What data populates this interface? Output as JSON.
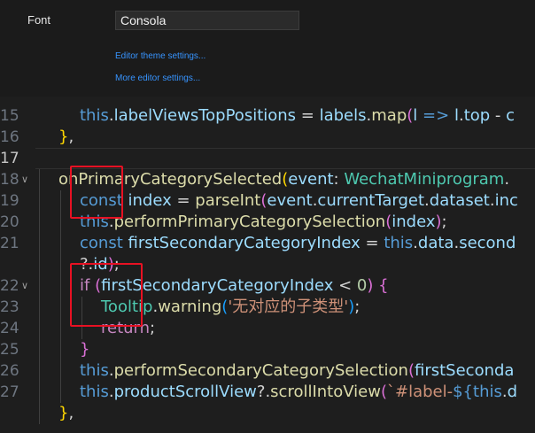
{
  "settings": {
    "font_label": "Font",
    "font_value": "Consola",
    "theme_link": "Editor theme settings...",
    "more_link": "More editor settings..."
  },
  "editor": {
    "line_numbers": [
      "15",
      "16",
      "17",
      "18",
      "19",
      "20",
      "21",
      "",
      "22",
      "23",
      "24",
      "25",
      "26",
      "27",
      ""
    ],
    "active_line": "17",
    "lines": [
      [
        [
          "kw",
          "this"
        ],
        [
          "pl",
          "."
        ],
        [
          "var",
          "labelViewsTopPositions"
        ],
        [
          "pl",
          " = "
        ],
        [
          "var",
          "labels"
        ],
        [
          "pl",
          "."
        ],
        [
          "fn",
          "map"
        ],
        [
          "br2",
          "("
        ],
        [
          "var",
          "l"
        ],
        [
          "pl",
          " "
        ],
        [
          "kw",
          "=>"
        ],
        [
          "pl",
          " "
        ],
        [
          "var",
          "l"
        ],
        [
          "pl",
          "."
        ],
        [
          "var",
          "top"
        ],
        [
          "pl",
          " - "
        ],
        [
          "var",
          "c"
        ]
      ],
      [
        [
          "br1",
          "}"
        ],
        [
          "pl",
          ","
        ]
      ],
      [],
      [
        [
          "fn",
          "onPrimaryCategorySelected"
        ],
        [
          "br1",
          "("
        ],
        [
          "var",
          "event"
        ],
        [
          "pl",
          ": "
        ],
        [
          "ty",
          "WechatMiniprogram"
        ],
        [
          "pl",
          "."
        ]
      ],
      [
        [
          "kw",
          "const"
        ],
        [
          "pl",
          " "
        ],
        [
          "var",
          "index"
        ],
        [
          "pl",
          " = "
        ],
        [
          "fn",
          "parseInt"
        ],
        [
          "br2",
          "("
        ],
        [
          "var",
          "event"
        ],
        [
          "pl",
          "."
        ],
        [
          "var",
          "currentTarget"
        ],
        [
          "pl",
          "."
        ],
        [
          "var",
          "dataset"
        ],
        [
          "pl",
          "."
        ],
        [
          "var",
          "inc"
        ]
      ],
      [
        [
          "kw",
          "this"
        ],
        [
          "pl",
          "."
        ],
        [
          "fn",
          "performPrimaryCategorySelection"
        ],
        [
          "br2",
          "("
        ],
        [
          "var",
          "index"
        ],
        [
          "br2",
          ")"
        ],
        [
          "pl",
          ";"
        ]
      ],
      [
        [
          "kw",
          "const"
        ],
        [
          "pl",
          " "
        ],
        [
          "var",
          "firstSecondaryCategoryIndex"
        ],
        [
          "pl",
          " = "
        ],
        [
          "kw",
          "this"
        ],
        [
          "pl",
          "."
        ],
        [
          "var",
          "data"
        ],
        [
          "pl",
          "."
        ],
        [
          "var",
          "second"
        ]
      ],
      [
        [
          "pl",
          "?."
        ],
        [
          "var",
          "id"
        ],
        [
          "br2",
          ")"
        ],
        [
          "pl",
          ";"
        ]
      ],
      [
        [
          "ctl",
          "if"
        ],
        [
          "pl",
          " "
        ],
        [
          "br2",
          "("
        ],
        [
          "var",
          "firstSecondaryCategoryIndex"
        ],
        [
          "pl",
          " < "
        ],
        [
          "num",
          "0"
        ],
        [
          "br2",
          ")"
        ],
        [
          "pl",
          " "
        ],
        [
          "br2",
          "{"
        ]
      ],
      [
        [
          "ty",
          "Tooltip"
        ],
        [
          "pl",
          "."
        ],
        [
          "fn",
          "warning"
        ],
        [
          "br3",
          "("
        ],
        [
          "str",
          "'无对应的子类型'"
        ],
        [
          "br3",
          ")"
        ],
        [
          "pl",
          ";"
        ]
      ],
      [
        [
          "ctl",
          "return"
        ],
        [
          "pl",
          ";"
        ]
      ],
      [
        [
          "br2",
          "}"
        ]
      ],
      [
        [
          "kw",
          "this"
        ],
        [
          "pl",
          "."
        ],
        [
          "fn",
          "performSecondaryCategorySelection"
        ],
        [
          "br2",
          "("
        ],
        [
          "var",
          "firstSeconda"
        ]
      ],
      [
        [
          "kw",
          "this"
        ],
        [
          "pl",
          "."
        ],
        [
          "var",
          "productScrollView"
        ],
        [
          "pl",
          "?."
        ],
        [
          "fn",
          "scrollIntoView"
        ],
        [
          "br2",
          "("
        ],
        [
          "str",
          "`#label-"
        ],
        [
          "kw",
          "${"
        ],
        [
          "kw",
          "this"
        ],
        [
          "pl",
          "."
        ],
        [
          "var",
          "d"
        ]
      ],
      [
        [
          "br1",
          "}"
        ],
        [
          "pl",
          ","
        ]
      ]
    ]
  }
}
